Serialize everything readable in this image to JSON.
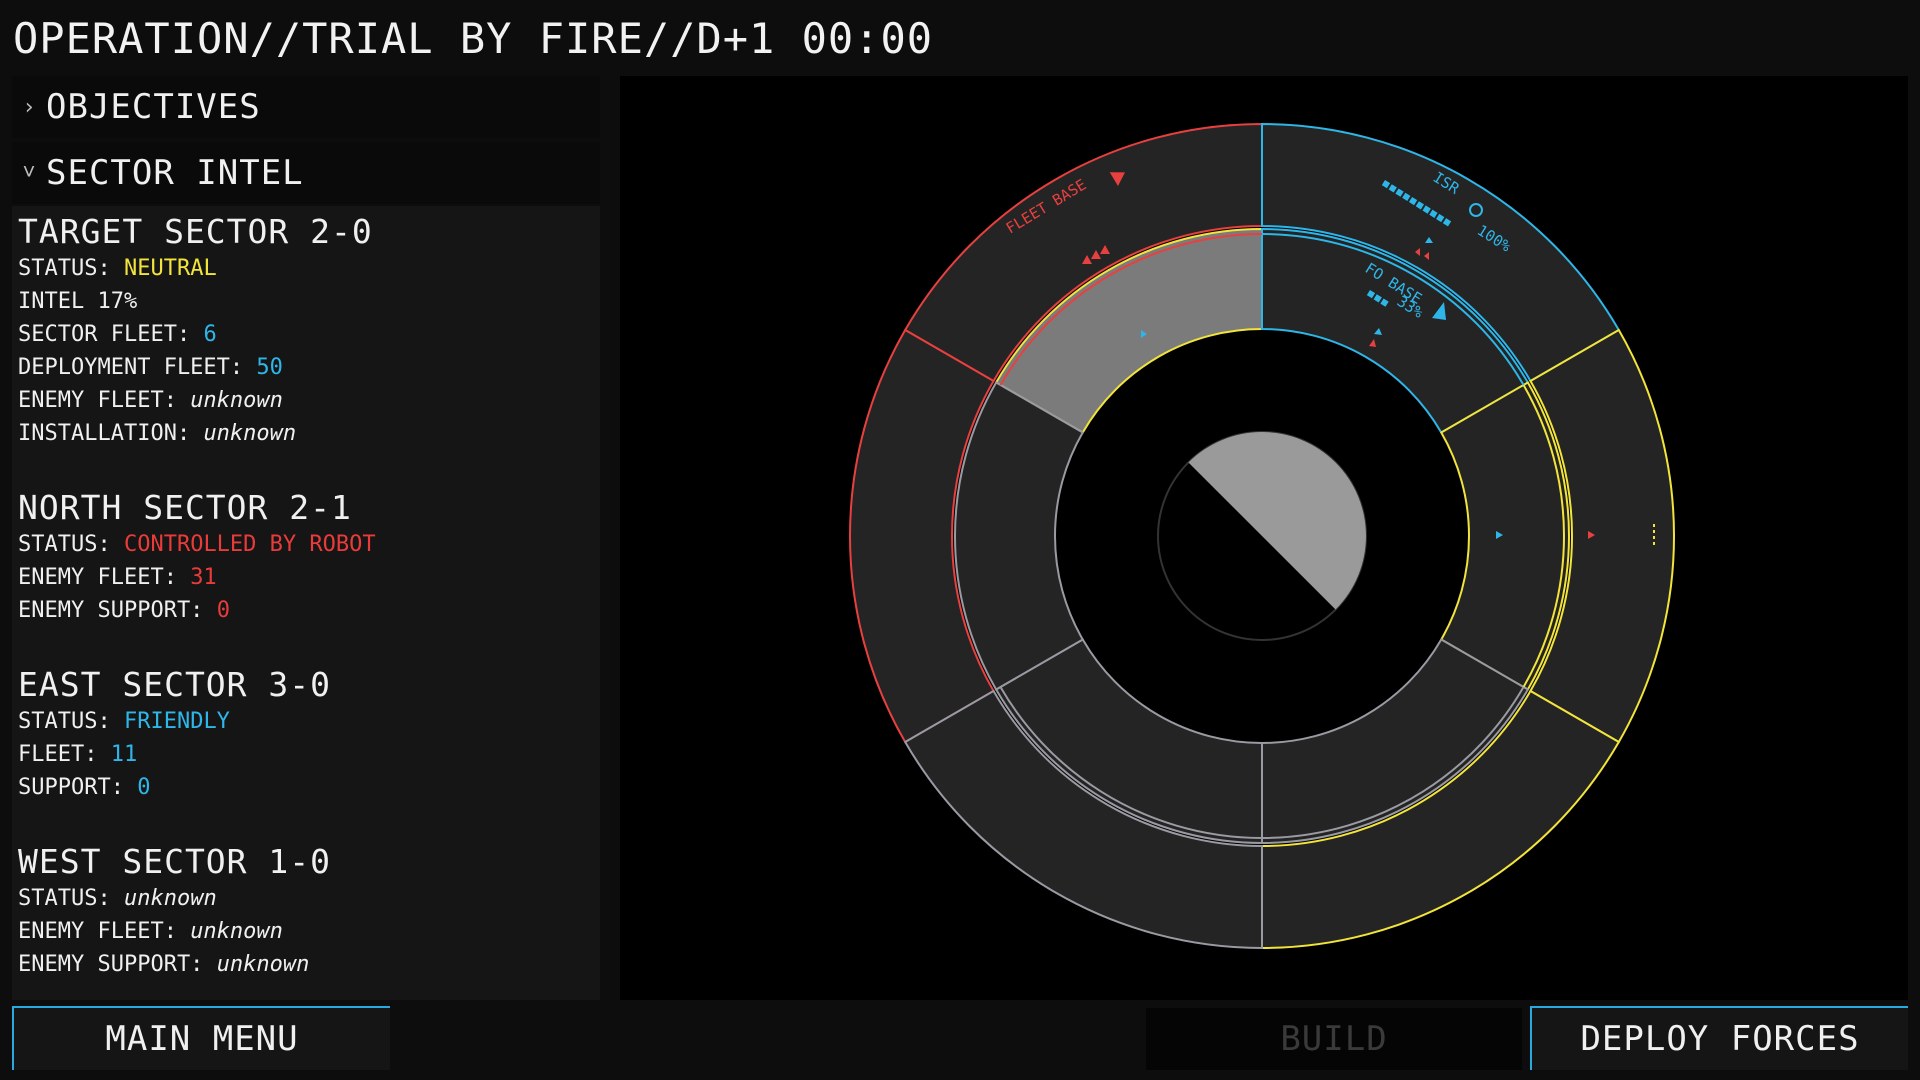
{
  "header": {
    "title": "OPERATION//TRIAL BY FIRE//D+1 00:00"
  },
  "panels": {
    "objectives": {
      "label": "OBJECTIVES",
      "chevron": "›",
      "icon": "chevron-right-icon"
    },
    "sector_intel": {
      "label": "SECTOR INTEL",
      "chevron": "˅",
      "icon": "chevron-down-icon"
    }
  },
  "sectors": {
    "target": {
      "title": "TARGET SECTOR 2-0",
      "status_label": "STATUS: ",
      "status_value": "NEUTRAL",
      "intel": "INTEL 17%",
      "sector_fleet_label": "SECTOR FLEET: ",
      "sector_fleet_value": "6",
      "deployment_fleet_label": "DEPLOYMENT FLEET: ",
      "deployment_fleet_value": "50",
      "enemy_fleet_label": "ENEMY FLEET: ",
      "enemy_fleet_value": "unknown",
      "installation_label": "INSTALLATION: ",
      "installation_value": "unknown"
    },
    "north": {
      "title": "NORTH SECTOR 2-1",
      "status_label": "STATUS: ",
      "status_value": "CONTROLLED BY ROBOT",
      "enemy_fleet_label": "ENEMY FLEET: ",
      "enemy_fleet_value": "31",
      "enemy_support_label": "ENEMY SUPPORT: ",
      "enemy_support_value": "0"
    },
    "east": {
      "title": "EAST SECTOR 3-0",
      "status_label": "STATUS: ",
      "status_value": "FRIENDLY",
      "fleet_label": "FLEET: ",
      "fleet_value": "11",
      "support_label": "SUPPORT: ",
      "support_value": "0"
    },
    "west": {
      "title": "WEST SECTOR 1-0",
      "status_label": "STATUS: ",
      "status_value": "unknown",
      "enemy_fleet_label": "ENEMY FLEET: ",
      "enemy_fleet_value": "unknown",
      "enemy_support_label": "ENEMY SUPPORT: ",
      "enemy_support_value": "unknown"
    }
  },
  "map": {
    "fleet_base_label": "FLEET BASE",
    "isr_label": "ISR",
    "isr_percent": "100%",
    "fo_base_label": "FO BASE",
    "fo_base_percent": "33%",
    "colors": {
      "robot": "#e8403f",
      "friendly": "#2fb6e8",
      "neutral": "#f2e43b",
      "unknown": "#9a9aa3"
    }
  },
  "footer": {
    "main_menu": "MAIN MENU",
    "build": "BUILD",
    "deploy": "DEPLOY FORCES"
  }
}
